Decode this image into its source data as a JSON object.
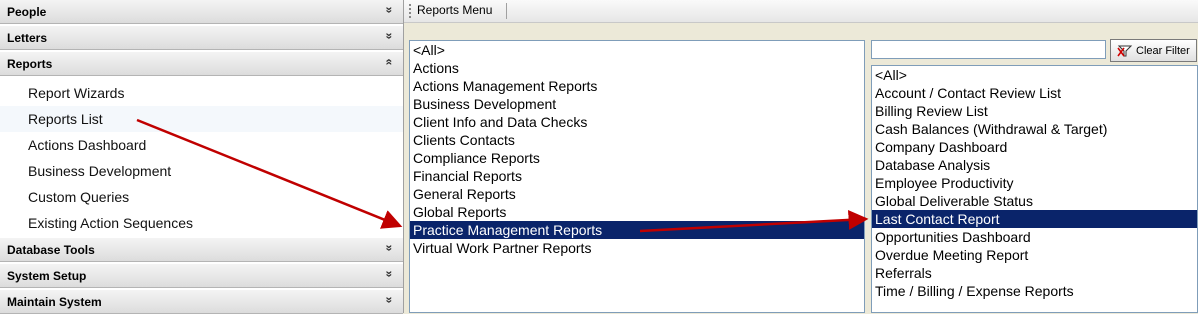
{
  "sidebar": {
    "sections": [
      {
        "title": "People",
        "chevron": "»"
      },
      {
        "title": "Letters",
        "chevron": "»"
      },
      {
        "title": "Reports",
        "chevron": "«"
      },
      {
        "title": "Database Tools",
        "chevron": "»"
      },
      {
        "title": "System Setup",
        "chevron": "»"
      },
      {
        "title": "Maintain System",
        "chevron": "»"
      }
    ],
    "report_items": [
      "Report Wizards",
      "Reports List",
      "Actions Dashboard",
      "Business Development",
      "Custom Queries",
      "Existing Action Sequences"
    ]
  },
  "toolbar": {
    "menu_label": "Reports Menu"
  },
  "categories": {
    "items": [
      "<All>",
      "Actions",
      "Actions Management Reports",
      "Business Development",
      "Client Info and Data Checks",
      "Clients Contacts",
      "Compliance Reports",
      "Financial Reports",
      "General Reports",
      "Global Reports",
      "Practice Management Reports",
      "Virtual Work Partner Reports"
    ],
    "selected_index": 10
  },
  "filter": {
    "value": "",
    "clear_label": "Clear Filter"
  },
  "reports": {
    "items": [
      "<All>",
      "Account / Contact Review List",
      "Billing Review List",
      "Cash Balances (Withdrawal & Target)",
      "Company Dashboard",
      "Database Analysis",
      "Employee Productivity",
      "Global Deliverable Status",
      "Last Contact Report",
      "Opportunities Dashboard",
      "Overdue Meeting Report",
      "Referrals",
      "Time / Billing / Expense Reports"
    ],
    "selected_index": 8
  },
  "colors": {
    "selection": "#0a246a",
    "annotation_arrow": "#c00000"
  }
}
